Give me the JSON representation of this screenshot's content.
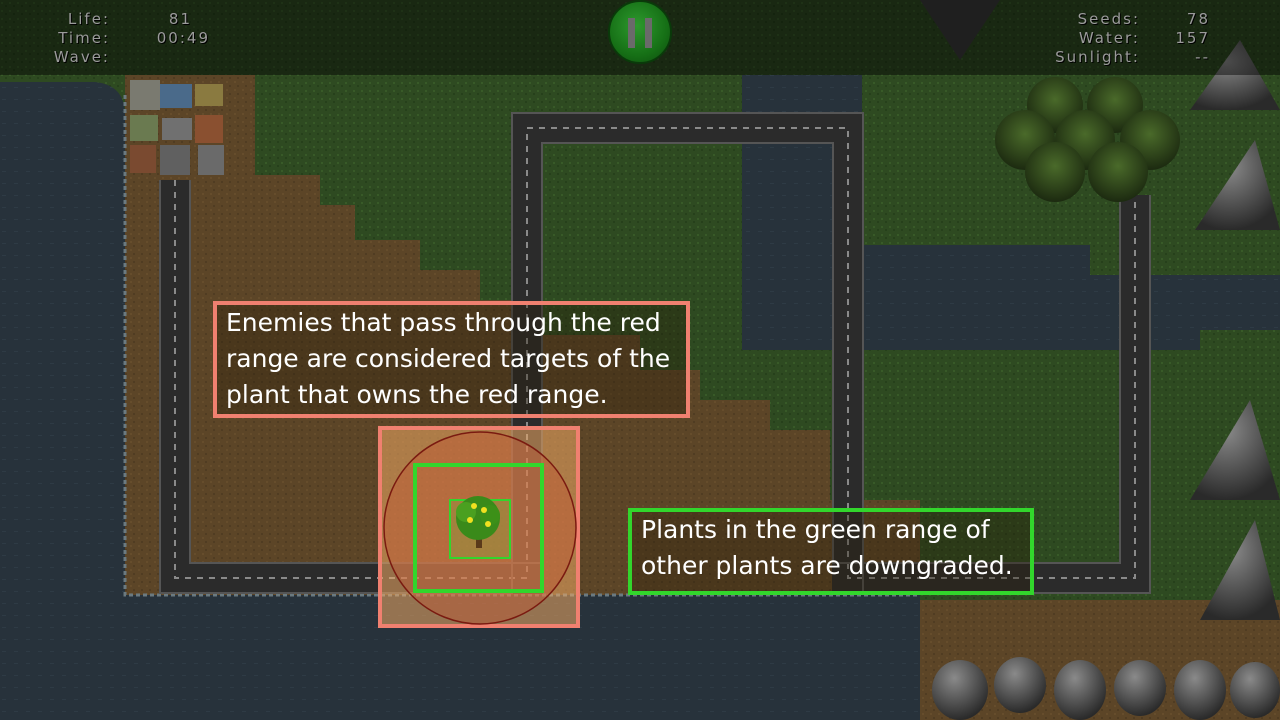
{
  "hud": {
    "left": [
      {
        "label": "Life:",
        "value": "81"
      },
      {
        "label": "Time:",
        "value": "00:49"
      },
      {
        "label": "Wave:",
        "value": ""
      }
    ],
    "right": [
      {
        "label": "Seeds:",
        "value": "78"
      },
      {
        "label": "Water:",
        "value": "157"
      },
      {
        "label": "Sunlight:",
        "value": "--"
      }
    ]
  },
  "pause_button": {
    "icon": "pause-icon"
  },
  "tutorial": {
    "red_range_text": [
      "Enemies that pass through the red",
      "range are considered targets of the",
      "plant that owns the red range."
    ],
    "green_range_text": [
      "Plants in the green range of",
      "other plants are downgraded."
    ]
  },
  "colors": {
    "red_range": "#f08070",
    "green_range": "#32d62c",
    "pause_button": "#167016",
    "water": "#26313a",
    "grass": "#2d4720",
    "dirt": "#5a4426",
    "road": "#2a2a2a"
  }
}
